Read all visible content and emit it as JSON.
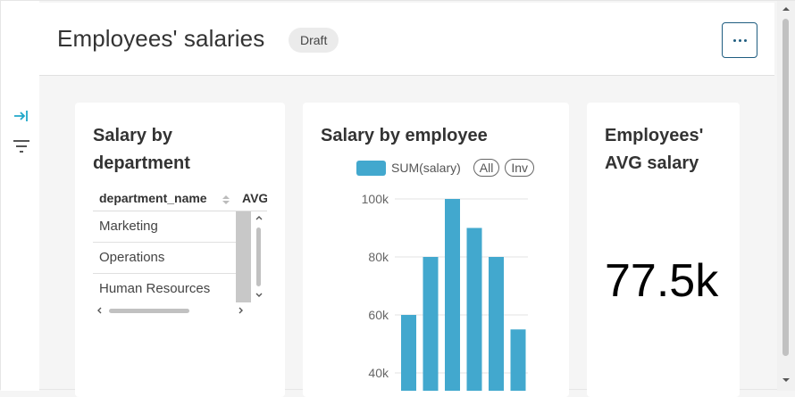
{
  "header": {
    "title": "Employees' salaries",
    "badge": "Draft"
  },
  "sidebar": {
    "icons": [
      "expand-panel-icon",
      "filter-icon"
    ]
  },
  "cards": {
    "department": {
      "title": "Salary by department",
      "columns": [
        "department_name",
        "AVG"
      ],
      "rows": [
        "Marketing",
        "Operations",
        "Human Resources"
      ]
    },
    "employee": {
      "title": "Salary by employee",
      "legend_label": "SUM(salary)",
      "pill_all": "All",
      "pill_inv": "Inv"
    },
    "avg": {
      "title": "Employees' AVG salary",
      "value": "77.5k"
    }
  },
  "chart_data": {
    "type": "bar",
    "title": "Salary by employee",
    "series": [
      {
        "name": "SUM(salary)",
        "values": [
          60000,
          80000,
          100000,
          90000,
          80000,
          55000
        ]
      }
    ],
    "y_ticks": [
      "100k",
      "80k",
      "60k",
      "40k"
    ],
    "ylim_visible": [
      35000,
      100000
    ],
    "color": "#42a8ce"
  }
}
